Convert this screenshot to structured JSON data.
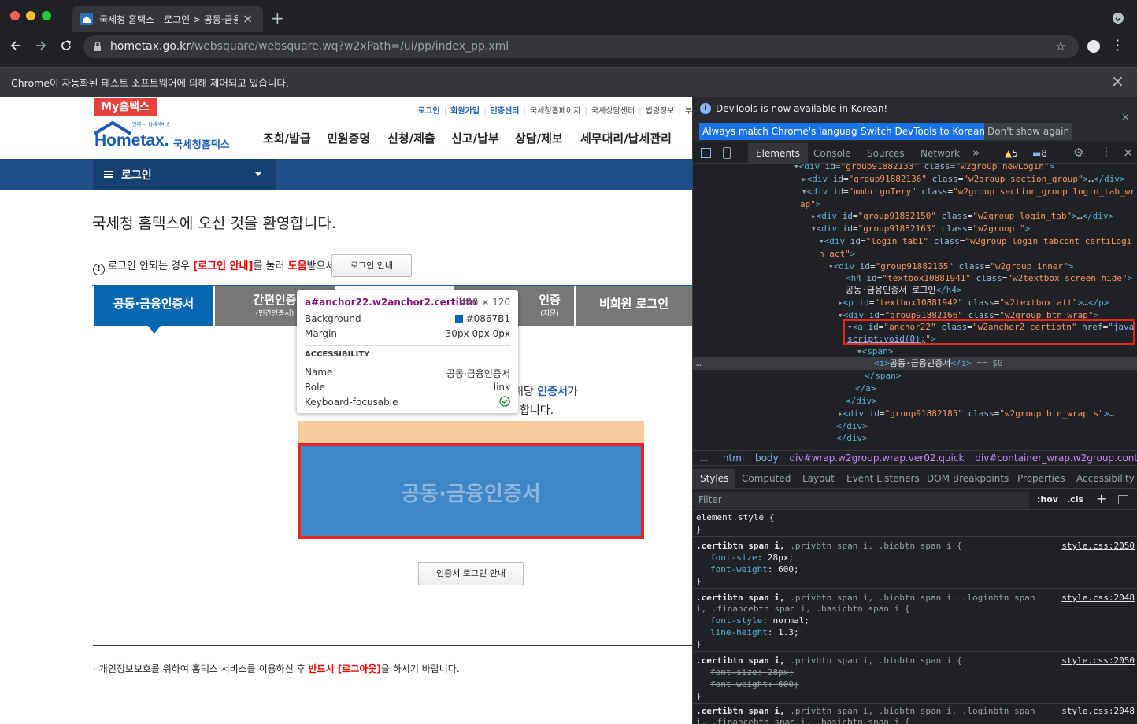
{
  "browser": {
    "tab_title": "국세청 홈택스 - 로그인 > 공동·금융인",
    "url_host": "hometax.go.kr",
    "url_path": "/websquare/websquare.wq?w2xPath=/ui/pp/index_pp.xml",
    "infobar_text": "Chrome이 자동화된 테스트 소프트웨어에 의해 제어되고 있습니다."
  },
  "site": {
    "my_label": "My홈택스",
    "top_links": [
      "로그인",
      "회원가입",
      "인증센터",
      "국세청홈페이지",
      "국세상담센터",
      "법령정보",
      "부서"
    ],
    "logo_small": "언제 나 납세서비스",
    "logo_main": "Hometax.",
    "logo_sub": "국세청홈택스",
    "gnb": [
      "조회/발급",
      "민원증명",
      "신청/제출",
      "신고/납부",
      "상담/제보",
      "세무대리/납세관리"
    ],
    "section_menu": "로그인",
    "welcome": "국세청 홈택스에 오신 것을 환영합니다.",
    "notice_prefix": "로그인 안되는 경우",
    "notice_red1": "[로그인 안내]",
    "notice_mid": "를 눌러",
    "notice_red2": "도움",
    "notice_suffix": "받으세요.",
    "notice_button": "로그인 안내",
    "tabs": [
      {
        "label": "공동·금융인증서",
        "sub": ""
      },
      {
        "label": "간편인증",
        "sub": "(민간인증서)"
      },
      {
        "label": "인증",
        "sub": "(지문)"
      },
      {
        "label": "비회원 로그인",
        "sub": ""
      }
    ],
    "desc_line1_pre": "해당",
    "desc_line1_blue": "인증서",
    "desc_line1_post": "가",
    "desc_line2": "합니다.",
    "cert_button": "공동·금융인증서",
    "guide_button": "인증서 로그인 안내",
    "footer_pre": "개인정보보호를 위하여 홈택스 서비스를 이용하신 후",
    "footer_red": "반드시 [로그아웃]",
    "footer_post": "을 하시기 바랍니다."
  },
  "tooltip": {
    "selector": "a#anchor22.w2anchor2.certibtn",
    "size": "440 × 120",
    "bg_label": "Background",
    "bg_value": "#0867B1",
    "margin_label": "Margin",
    "margin_value": "30px 0px 0px",
    "access_title": "ACCESSIBILITY",
    "name_label": "Name",
    "name_value": "공동·금융인증서",
    "role_label": "Role",
    "role_value": "link",
    "kf_label": "Keyboard-focusable"
  },
  "devtools": {
    "notice": "DevTools is now available in Korean!",
    "btn_match": "Always match Chrome's language",
    "btn_switch": "Switch DevTools to Korean",
    "btn_dont": "Don't show again",
    "tabs": [
      "Elements",
      "Console",
      "Sources",
      "Network"
    ],
    "warn_count": "5",
    "msg_count": "8",
    "breadcrumb": [
      "html",
      "body",
      "div#wrap.w2group.wrap.ver02.quick",
      "div#container_wrap.w2group.container"
    ],
    "style_tabs": [
      "Styles",
      "Computed",
      "Layout",
      "Event Listeners",
      "DOM Breakpoints",
      "Properties",
      "Accessibility"
    ],
    "filter": "Filter",
    "hov": ":hov",
    ".cls": ".cls",
    "element_style": "element.style {",
    "rules": [
      {
        "sel": ".certibtn span i,",
        "rest": " .privbtn span i, .biobtn span i {",
        "src": "style.css:2050",
        "props": [
          [
            "font-size",
            "28px;"
          ],
          [
            "font-weight",
            "600;"
          ]
        ]
      },
      {
        "sel": ".certibtn span i,",
        "rest": " .privbtn span i, .biobtn span i, .loginbtn span",
        "rest2": "i, .financebtn span i, .basicbtn span i {",
        "src": "style.css:2048",
        "props": [
          [
            "font-style",
            "normal;"
          ],
          [
            "line-height",
            "1.3;"
          ]
        ]
      },
      {
        "sel": ".certibtn span i,",
        "rest": " .privbtn span i, .biobtn span i {",
        "src": "style.css:2050",
        "props": [
          [
            "font-size",
            "28px;"
          ],
          [
            "font-weight",
            "600;"
          ]
        ]
      },
      {
        "sel": ".certibtn span i,",
        "rest": " .privbtn span i, .biobtn span i, .loginbtn span",
        "rest2": "i, .financebtn span i, .basicbtn span i {",
        "src": "style.css:2048"
      }
    ]
  }
}
